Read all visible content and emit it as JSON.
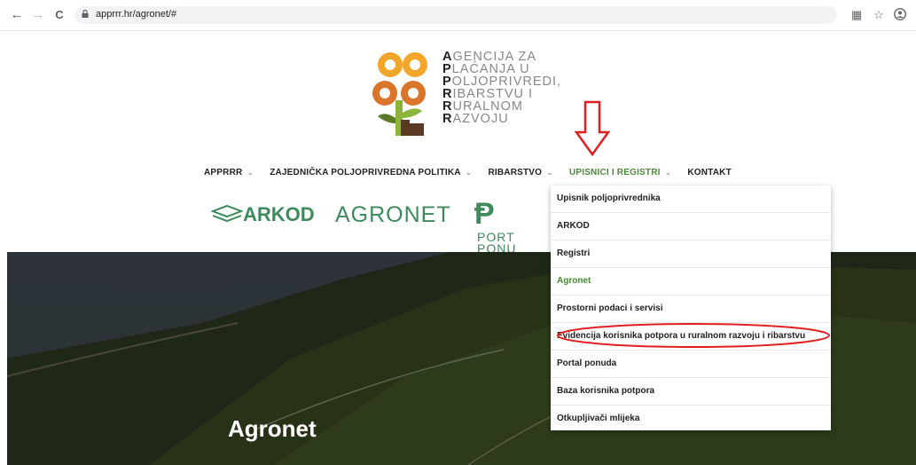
{
  "browser": {
    "url": "apprrr.hr/agronet/#",
    "back_icon": "←",
    "forward_icon": "→",
    "reload_icon": "C"
  },
  "logo": {
    "lines": [
      {
        "first": "A",
        "rest": "GENCIJA ZA"
      },
      {
        "first": "P",
        "rest": "LAĆANJA U"
      },
      {
        "first": "P",
        "rest": "OLJOPRIVREDI,"
      },
      {
        "first": "R",
        "rest": "IBARSTVU I"
      },
      {
        "first": "R",
        "rest": "URALNOM"
      },
      {
        "first": "R",
        "rest": "AZVOJU"
      }
    ]
  },
  "nav": {
    "items": [
      {
        "label": "APPRRR",
        "chevron": "⌄"
      },
      {
        "label": "ZAJEDNIČKA POLJOPRIVREDNA POLITIKA",
        "chevron": "⌄"
      },
      {
        "label": "RIBARSTVO",
        "chevron": "⌄"
      },
      {
        "label": "UPISNICI I REGISTRI",
        "chevron": "⌄"
      },
      {
        "label": "KONTAKT",
        "chevron": ""
      }
    ]
  },
  "partners": {
    "arkod": "ARKOD",
    "agronet": "AGRONET",
    "portal_line1": "PORT",
    "portal_line2": "PONU"
  },
  "dropdown": {
    "items": [
      "Upisnik poljoprivrednika",
      "ARKOD",
      "Registri",
      "Agronet",
      "Prostorni podaci i servisi",
      "Evidencija korisnika potpora u ruralnom razvoju i ribarstvu",
      "Portal ponuda",
      "Baza korisnika potpora",
      "Otkupljivači mlijeka"
    ]
  },
  "hero": {
    "title": "Agronet"
  },
  "colors": {
    "brand_green": "#3f8a5c",
    "active_green": "#4a8a3a",
    "annotation_red": "#e02020"
  }
}
